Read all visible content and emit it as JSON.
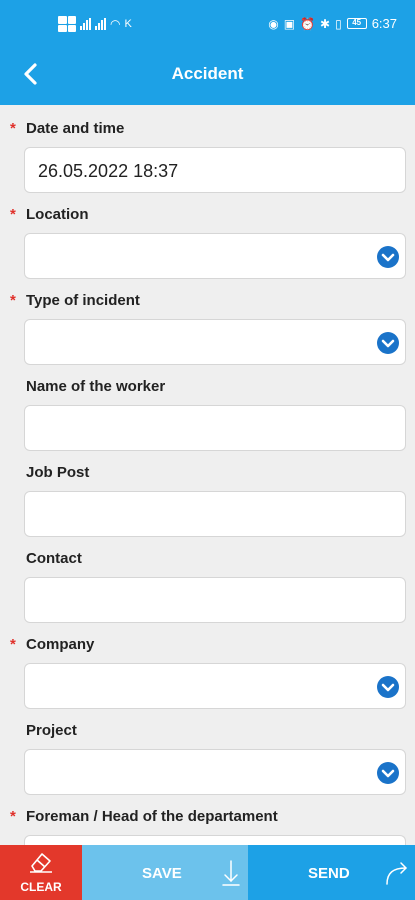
{
  "status_bar": {
    "left_letter": "K",
    "time": "6:37",
    "battery": "45"
  },
  "header": {
    "title": "Accident"
  },
  "fields": [
    {
      "label": "Date and time",
      "value": "26.05.2022 18:37"
    },
    {
      "label": "Location",
      "value": ""
    },
    {
      "label": "Type of incident",
      "value": ""
    },
    {
      "label": "Name of the worker",
      "value": ""
    },
    {
      "label": "Job Post",
      "value": ""
    },
    {
      "label": "Contact",
      "value": ""
    },
    {
      "label": "Company",
      "value": ""
    },
    {
      "label": "Project",
      "value": ""
    },
    {
      "label": "Foreman / Head of the departament",
      "value": ""
    }
  ],
  "required_marker": "*",
  "footer": {
    "clear_label": "CLEAR",
    "save_label": "SAVE",
    "send_label": "SEND"
  },
  "colors": {
    "accent": "#1da1e6",
    "clear": "#e3382b",
    "save": "#6cc2ec",
    "dropdown_icon": "#1a73c9"
  }
}
